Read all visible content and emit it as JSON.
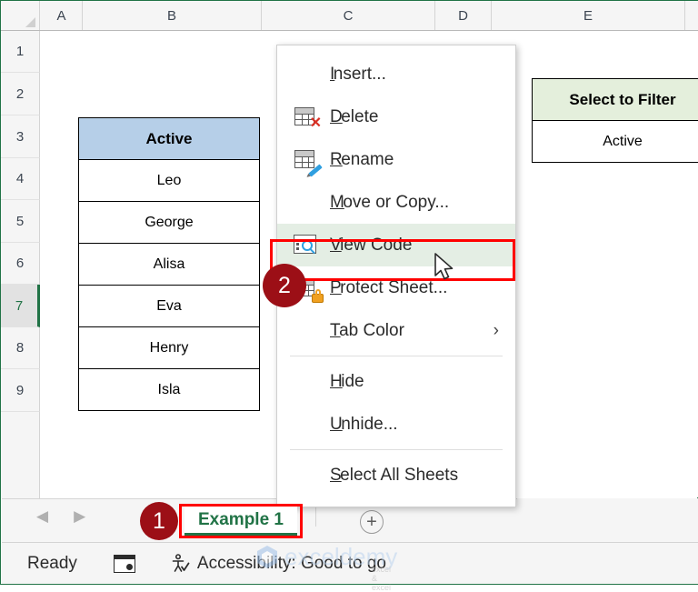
{
  "app": {
    "accent_green": "#217346",
    "annotation_red": "#ff0000",
    "badge_color": "#9c0f16"
  },
  "grid": {
    "column_headers": [
      "A",
      "B",
      "C",
      "D",
      "E"
    ],
    "row_headers": [
      "1",
      "2",
      "3",
      "4",
      "5",
      "6",
      "7",
      "8",
      "9"
    ],
    "active_row": "7"
  },
  "left_table": {
    "header": "Active",
    "header_fill": "#b6cfe8",
    "rows": [
      "Leo",
      "George",
      "Alisa",
      "Eva",
      "Henry",
      "Isla"
    ]
  },
  "right_table": {
    "header": "Select to Filter",
    "header_fill": "#e4efdc",
    "rows": [
      "Active"
    ]
  },
  "context_menu": {
    "items": [
      {
        "label": "Insert...",
        "accel": "I",
        "icon": "none",
        "highlight": false
      },
      {
        "label": "Delete",
        "accel": "D",
        "icon": "delete-sheet-icon",
        "highlight": false
      },
      {
        "label": "Rename",
        "accel": "R",
        "icon": "rename-sheet-icon",
        "highlight": false
      },
      {
        "label": "Move or Copy...",
        "accel": "M",
        "icon": "none",
        "highlight": false
      },
      {
        "label": "View Code",
        "accel": "V",
        "icon": "view-code-icon",
        "highlight": true
      },
      {
        "label": "Protect Sheet...",
        "accel": "P",
        "icon": "protect-sheet-icon",
        "highlight": false
      },
      {
        "label": "Tab Color",
        "accel": "T",
        "icon": "none",
        "highlight": false,
        "submenu": true
      },
      {
        "label": "Hide",
        "accel": "H",
        "icon": "none",
        "highlight": false
      },
      {
        "label": "Unhide...",
        "accel": "U",
        "icon": "none",
        "highlight": false
      },
      {
        "label": "Select All Sheets",
        "accel": "S",
        "icon": "none",
        "highlight": false
      }
    ],
    "submenu_arrow": "›"
  },
  "annotations": {
    "badge_1": "1",
    "badge_2": "2"
  },
  "tab_bar": {
    "prev_arrow": "◀",
    "next_arrow": "▶",
    "sheet_name": "Example 1",
    "add_sheet": "+"
  },
  "status_bar": {
    "mode": "Ready",
    "accessibility": "Accessibility: Good to go"
  },
  "watermark": {
    "text": "exceldemy",
    "sub": "excel & excel"
  }
}
